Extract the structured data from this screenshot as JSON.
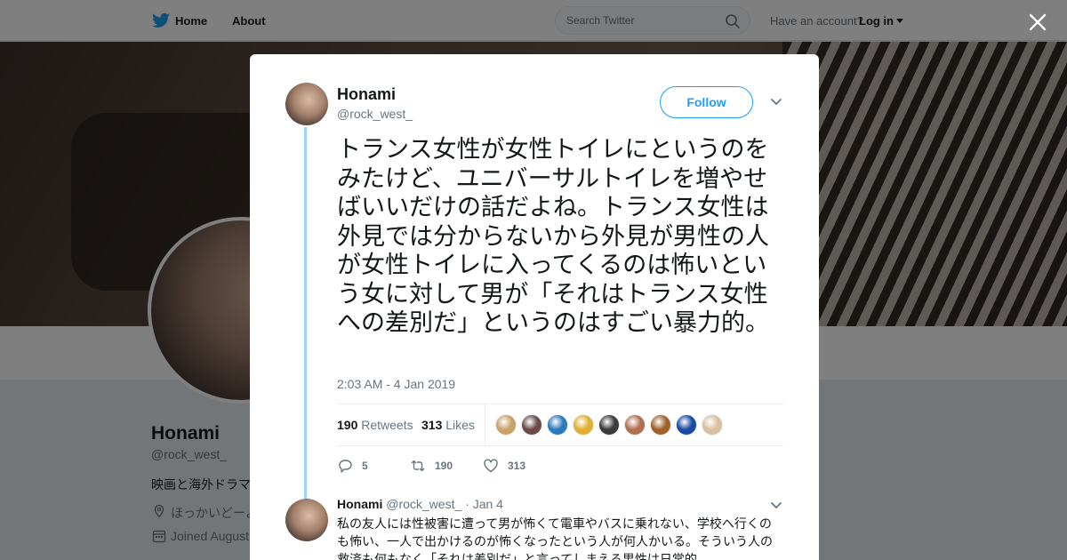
{
  "nav": {
    "home_label": "Home",
    "about_label": "About",
    "search_placeholder": "Search Twitter",
    "have_account": "Have an account?",
    "login_label": "Log in"
  },
  "profile": {
    "name": "Honami",
    "handle": "@rock_west_",
    "bio": "映画と海外ドラマ",
    "location": "ほっかいどーよ",
    "joined": "Joined August"
  },
  "tweet": {
    "author_name": "Honami",
    "author_handle": "@rock_west_",
    "follow_label": "Follow",
    "text": "トランス女性が女性トイレにというのをみたけど、ユニバーサルトイレを増やせばいいだけの話だよね。トランス女性は外見では分からないから外見が男性の人が女性トイレに入ってくるのは怖いという女に対して男が「それはトランス女性への差別だ」というのはすごい暴力的。",
    "timestamp": "2:03 AM - 4 Jan 2019",
    "retweets_count": "190",
    "retweets_label": "Retweets",
    "likes_count": "313",
    "likes_label": "Likes",
    "reply_count": "5",
    "retweet_action_count": "190",
    "like_action_count": "313",
    "likers_colors": [
      "#c9a26b",
      "#6b4a4a",
      "#2a7bbd",
      "#e0b030",
      "#3a3a3a",
      "#b07050",
      "#a0602a",
      "#1a4aa0",
      "#d8c0a0"
    ]
  },
  "reply": {
    "author_name": "Honami",
    "author_handle": "@rock_west_",
    "date": "· Jan 4",
    "text": "私の友人には性被害に遭って男が怖くて電車やバスに乗れない、学校へ行くのも怖い、一人で出かけるのが怖くなったという人が何人かいる。そういう人の救済も何もなく「それは差別だ」と言ってしまえる男性は日常的"
  },
  "colors": {
    "accent": "#1da1f2",
    "thread_line": "#9bd3f5",
    "muted": "#66757f"
  }
}
